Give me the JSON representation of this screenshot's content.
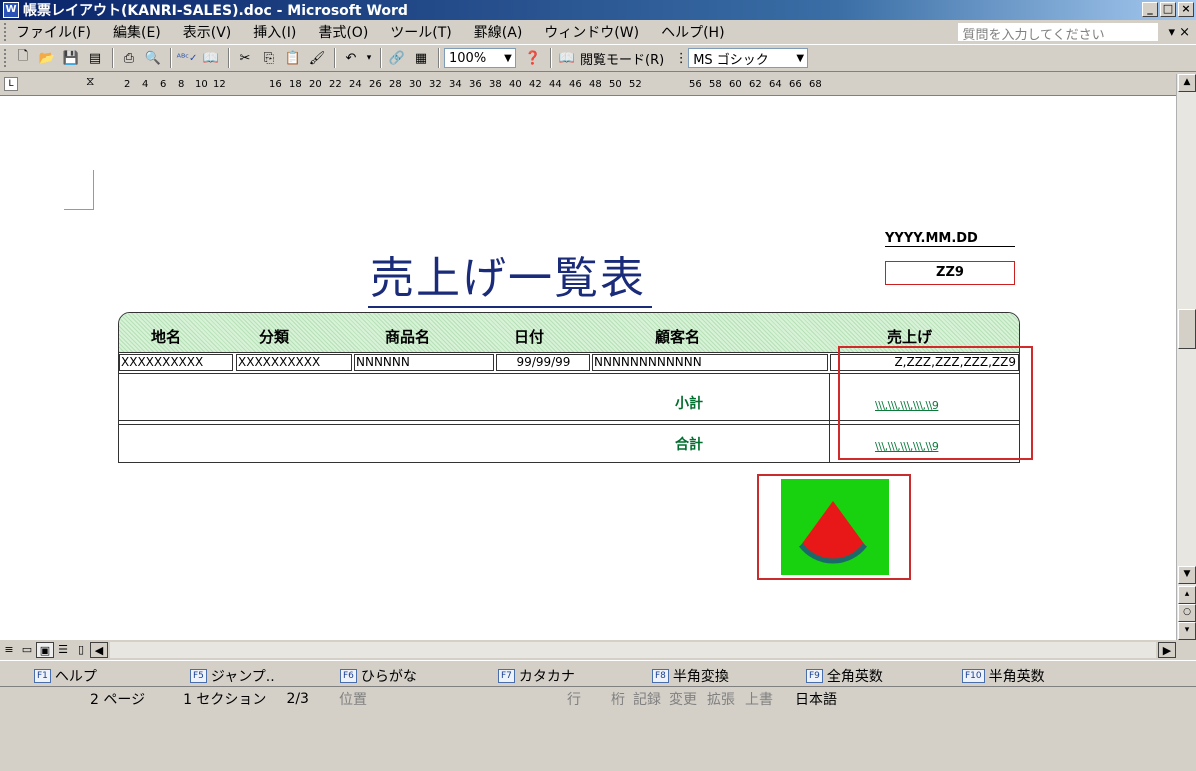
{
  "window": {
    "title": "帳票レイアウト(KANRI-SALES).doc - Microsoft Word",
    "app_icon": "word-icon"
  },
  "menu": {
    "items": [
      "ファイル(F)",
      "編集(E)",
      "表示(V)",
      "挿入(I)",
      "書式(O)",
      "ツール(T)",
      "罫線(A)",
      "ウィンドウ(W)",
      "ヘルプ(H)"
    ],
    "help_placeholder": "質問を入力してください"
  },
  "toolbar": {
    "zoom": "100%",
    "reading_mode": "閲覧モード(R)",
    "font": "MS ゴシック"
  },
  "ruler": {
    "ticks": [
      "2",
      "4",
      "6",
      "8",
      "10",
      "12",
      "16",
      "18",
      "20",
      "22",
      "24",
      "26",
      "28",
      "30",
      "32",
      "34",
      "36",
      "38",
      "40",
      "42",
      "44",
      "46",
      "48",
      "50",
      "52",
      "56",
      "58",
      "60",
      "62",
      "64",
      "66",
      "68"
    ]
  },
  "report": {
    "title": "売上げ一覧表",
    "date": "YYYY.MM.DD",
    "page_no": "ZZ9",
    "headers": [
      "地名",
      "分類",
      "商品名",
      "日付",
      "顧客名",
      "売上げ"
    ],
    "row": [
      "XXXXXXXXXX",
      "XXXXXXXXXX",
      "NNNNNN",
      "99/99/99",
      "NNNNNNNNNNNN",
      "Z,ZZZ,ZZZ,ZZZ,ZZ9"
    ],
    "subtotal_label": "小計",
    "total_label": "合計",
    "subtotal_value": "\\\\\\,\\\\\\,\\\\\\,\\\\\\,\\\\9",
    "total_value": "\\\\\\,\\\\\\,\\\\\\,\\\\\\,\\\\9"
  },
  "function_keys": [
    {
      "key": "F1",
      "label": "ヘルプ"
    },
    {
      "key": "F5",
      "label": "ジャンプ.."
    },
    {
      "key": "F6",
      "label": "ひらがな"
    },
    {
      "key": "F7",
      "label": "カタカナ"
    },
    {
      "key": "F8",
      "label": "半角変換"
    },
    {
      "key": "F9",
      "label": "全角英数"
    },
    {
      "key": "F10",
      "label": "半角英数"
    }
  ],
  "status": {
    "page": "2 ページ",
    "section": "1 セクション",
    "pages": "2/3",
    "position": "位置",
    "line": "行",
    "column": "桁",
    "rec": "記録",
    "trk": "変更",
    "ext": "拡張",
    "ovr": "上書",
    "lang": "日本語"
  },
  "colors": {
    "title_bar": "#0a246a",
    "header_fill": "#c9ecc9",
    "label_green": "#006e2e",
    "highlight_red": "#d02a2a",
    "pie_bg": "#18d20f",
    "pie_slice": "#e81818"
  }
}
